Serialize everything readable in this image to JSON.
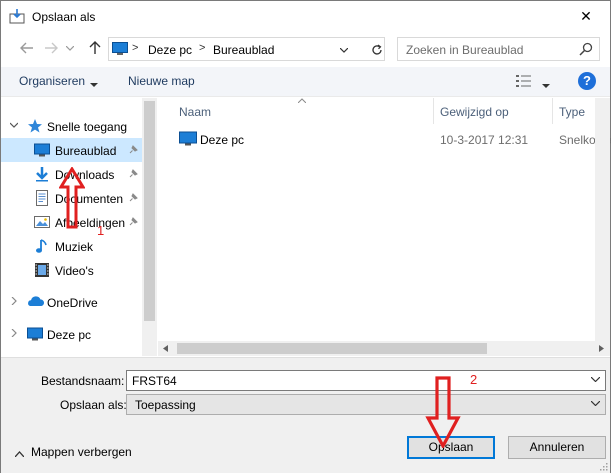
{
  "window": {
    "title": "Opslaan als",
    "close_glyph": "✕"
  },
  "address": {
    "crumbs": [
      "Deze pc",
      "Bureaublad"
    ],
    "separator": ">"
  },
  "search": {
    "placeholder": "Zoeken in Bureaublad"
  },
  "toolbar": {
    "organize_label": "Organiseren",
    "new_folder_label": "Nieuwe map",
    "help_label": "?"
  },
  "navpane": {
    "quick_access": "Snelle toegang",
    "items": [
      {
        "label": "Bureaublad",
        "icon": "desktop-icon",
        "pinned": true,
        "selected": true
      },
      {
        "label": "Downloads",
        "icon": "downloads-icon",
        "pinned": true
      },
      {
        "label": "Documenten",
        "icon": "documents-icon",
        "pinned": true
      },
      {
        "label": "Afbeeldingen",
        "icon": "pictures-icon",
        "pinned": true
      },
      {
        "label": "Muziek",
        "icon": "music-icon",
        "pinned": false
      },
      {
        "label": "Video's",
        "icon": "videos-icon",
        "pinned": false
      }
    ],
    "onedrive": "OneDrive",
    "thispc": "Deze pc"
  },
  "filelist": {
    "columns": [
      "Naam",
      "Gewijzigd op",
      "Type"
    ],
    "rows": [
      {
        "name": "Deze pc",
        "modified": "10-3-2017 12:31",
        "type": "Snelkoppeling"
      }
    ]
  },
  "form": {
    "filename_label": "Bestandsnaam:",
    "filename_value": "FRST64",
    "savetype_label": "Opslaan als:",
    "savetype_value": "Toepassing",
    "hide_folders_label": "Mappen verbergen",
    "save_button": "Opslaan",
    "cancel_button": "Annuleren"
  },
  "annotations": {
    "step1": "1",
    "step2": "2"
  },
  "colors": {
    "accent": "#0078d7",
    "selected_bg": "#cce8ff",
    "annotation": "#e02020"
  }
}
